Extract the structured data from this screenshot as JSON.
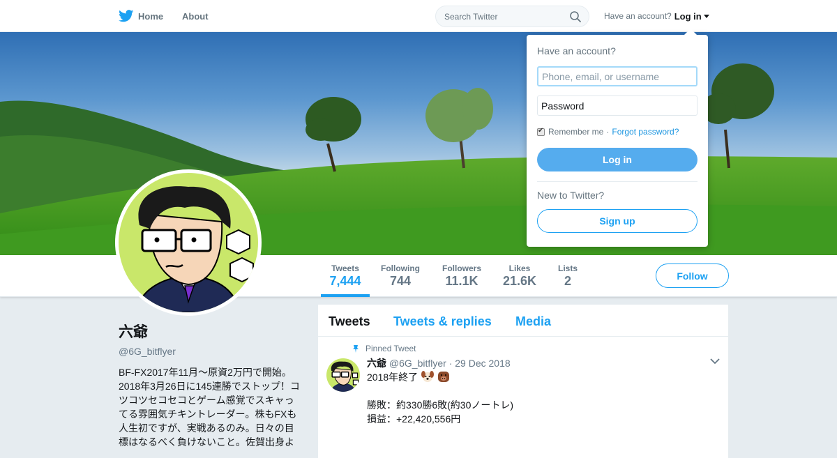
{
  "topbar": {
    "home_label": "Home",
    "about_label": "About",
    "search_placeholder": "Search Twitter",
    "account_prompt": "Have an account?",
    "login_label": "Log in"
  },
  "profile": {
    "name": "六爺",
    "handle": "@6G_bitflyer",
    "bio": "BF-FX2017年11月～原資2万円で開始。2018年3月26日に145連勝でストップ！コツコツセコセコとゲーム感覚でスキャってる雰囲気チキントレーダー。株もFXも人生初ですが、実戦あるのみ。日々の目標はなるべく負けないこと。佐賀出身よ"
  },
  "stats": [
    {
      "label": "Tweets",
      "value": "7,444"
    },
    {
      "label": "Following",
      "value": "744"
    },
    {
      "label": "Followers",
      "value": "11.1K"
    },
    {
      "label": "Likes",
      "value": "21.6K"
    },
    {
      "label": "Lists",
      "value": "2"
    }
  ],
  "follow_label": "Follow",
  "timeline": {
    "tabs": [
      "Tweets",
      "Tweets & replies",
      "Media"
    ],
    "tweet": {
      "pinned_label": "Pinned Tweet",
      "name": "六爺",
      "handle": "@6G_bitflyer",
      "date": "· 29 Dec 2018",
      "line1": "2018年終了",
      "line2": "勝敗：約330勝6敗(約30ノートレ)",
      "line3": "損益：+22,420,556円"
    }
  },
  "login_dropdown": {
    "title": "Have an account?",
    "username_placeholder": "Phone, email, or username",
    "password_placeholder": "Password",
    "remember_label": "Remember me",
    "separator": "·",
    "forgot_label": "Forgot password?",
    "login_button": "Log in",
    "new_prompt": "New to Twitter?",
    "signup_button": "Sign up"
  },
  "colors": {
    "brand": "#1da1f2",
    "login_button": "#55acee",
    "avatar_bg": "#c9e76a"
  }
}
